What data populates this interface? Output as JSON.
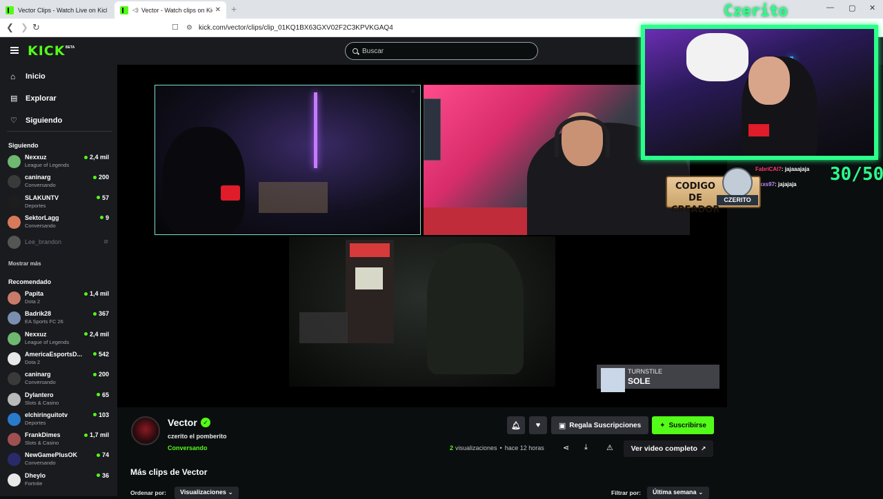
{
  "browser": {
    "tabs": [
      {
        "title": "Vector Clips - Watch Live on Kick",
        "active": false
      },
      {
        "title": "Vector - Watch clips on Kick",
        "active": true
      }
    ],
    "url": "kick.com/vector/clips/clip_01KQ1BX63GXV02F2C3KPVKGAQ4"
  },
  "header": {
    "logo": "KICK",
    "logo_badge": "BETA",
    "search_placeholder": "Buscar"
  },
  "sidebar": {
    "nav": [
      {
        "label": "Inicio",
        "icon": "home-icon"
      },
      {
        "label": "Explorar",
        "icon": "browse-icon"
      },
      {
        "label": "Siguiendo",
        "icon": "heart-icon"
      }
    ],
    "following_title": "Siguiendo",
    "following": [
      {
        "name": "Nexxuz",
        "category": "League of Legends",
        "viewers": "2,4 mil",
        "color": "#6fb86f"
      },
      {
        "name": "caninarg",
        "category": "Conversando",
        "viewers": "200",
        "color": "#3a3a3a"
      },
      {
        "name": "SLAKUNTV",
        "category": "Deportes",
        "viewers": "57",
        "color": "#1d1d1d"
      },
      {
        "name": "SektorLagg",
        "category": "Conversando",
        "viewers": "9",
        "color": "#d77a5a"
      },
      {
        "name": "Lee_brandon",
        "category": "",
        "viewers": "",
        "color": "#555555",
        "offline": true
      }
    ],
    "show_more": "Mostrar más",
    "recommended_title": "Recomendado",
    "recommended": [
      {
        "name": "Papita",
        "category": "Dota 2",
        "viewers": "1,4 mil",
        "color": "#c97b6a"
      },
      {
        "name": "Badrik28",
        "category": "EA Sports FC 26",
        "viewers": "367",
        "color": "#7a8fb0"
      },
      {
        "name": "Nexxuz",
        "category": "League of Legends",
        "viewers": "2,4 mil",
        "color": "#6fb86f"
      },
      {
        "name": "AmericaEsportsD...",
        "category": "Dota 2",
        "viewers": "542",
        "color": "#e8e8e8"
      },
      {
        "name": "caninarg",
        "category": "Conversando",
        "viewers": "200",
        "color": "#3a3a3a"
      },
      {
        "name": "Dylantero",
        "category": "Slots & Casino",
        "viewers": "65",
        "color": "#b9b9b9"
      },
      {
        "name": "elchiringuitotv",
        "category": "Deportes",
        "viewers": "103",
        "color": "#2a7acc"
      },
      {
        "name": "FrankDimes",
        "category": "Slots & Casino",
        "viewers": "1,7 mil",
        "color": "#a05050"
      },
      {
        "name": "NewGamePlusOK",
        "category": "Conversando",
        "viewers": "74",
        "color": "#2a2a6a"
      },
      {
        "name": "Dheylo",
        "category": "Fortnite",
        "viewers": "36",
        "color": "#e8e8e8"
      }
    ]
  },
  "video": {
    "overlay_name": "Czerito",
    "counter": "30/50",
    "chat": [
      {
        "user": "FabriCAI7",
        "text": "jajaaajaja"
      },
      {
        "user": "Axxs97",
        "text": "jajajaja"
      }
    ],
    "code_banner": "CODIGO DE CREADOR",
    "code_tag": "CZERITO",
    "now_playing": {
      "artist": "TURNSTILE",
      "song": "SOLE"
    }
  },
  "clip": {
    "channel": "Vector",
    "title": "czerito el pomberito",
    "category": "Conversando",
    "gift_label": "Regala Suscripciones",
    "subscribe_label": "Suscribirse",
    "views_count": "2",
    "views_label": "visualizaciones",
    "time_ago": "hace 12 horas",
    "full_video_label": "Ver video completo",
    "more_clips_title": "Más clips de Vector",
    "sort_label": "Ordenar por:",
    "sort_value": "Visualizaciones",
    "filter_label": "Filtrar por:",
    "filter_value": "Última semana"
  },
  "colors": {
    "accent": "#53fc18",
    "overlay_green": "#2bff8a",
    "bg": "#0b0e0f",
    "panel": "#191b1f"
  }
}
